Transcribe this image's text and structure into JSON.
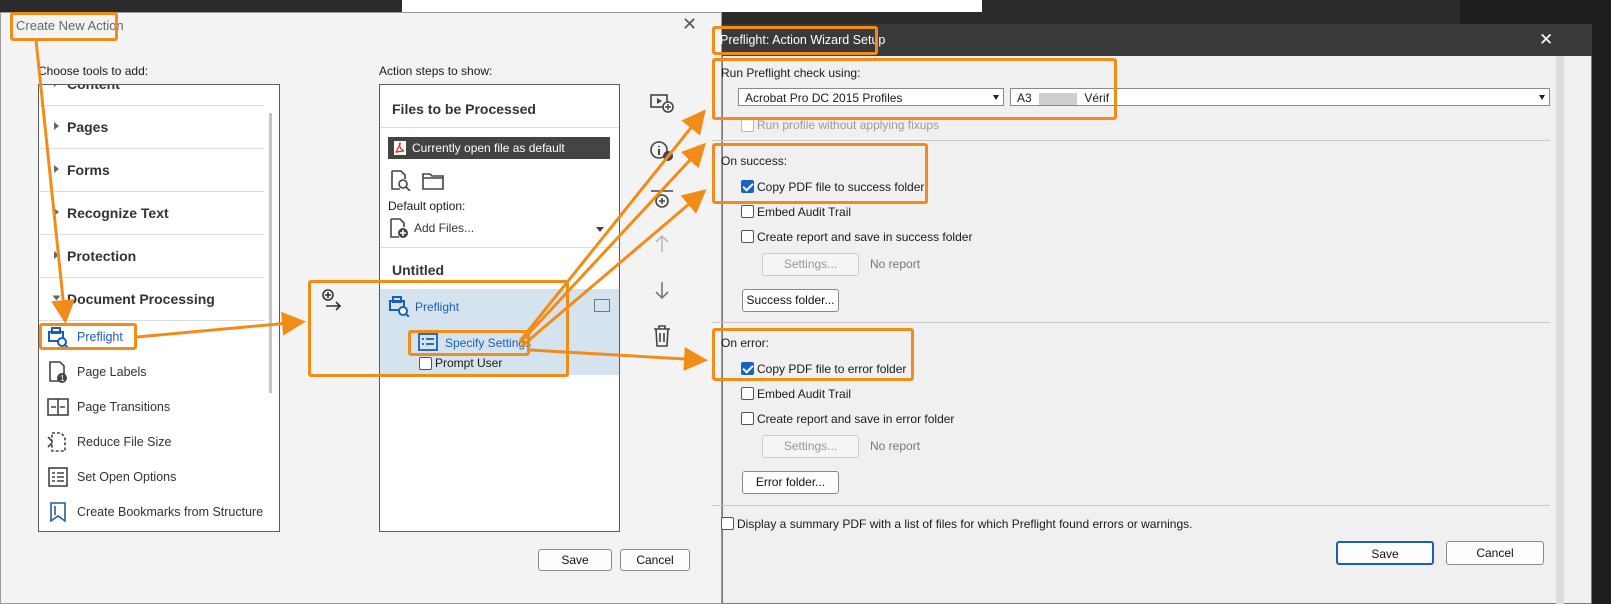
{
  "create_action": {
    "title": "Create New Action",
    "choose_tools_label": "Choose tools to add:",
    "action_steps_label": "Action steps to show:",
    "categories": [
      "Content",
      "Pages",
      "Forms",
      "Recognize Text",
      "Protection",
      "Document Processing"
    ],
    "tools": [
      "Preflight",
      "Page Labels",
      "Page Transitions",
      "Reduce File Size",
      "Set Open Options",
      "Create Bookmarks from Structure"
    ],
    "files_header": "Files to be Processed",
    "open_file_label": "Currently open file as default",
    "default_option_label": "Default option:",
    "add_files_label": "Add Files...",
    "untitled_header": "Untitled",
    "step_preflight": "Preflight",
    "step_specify": "Specify Settings",
    "step_prompt": "Prompt User",
    "save_label": "Save",
    "cancel_label": "Cancel"
  },
  "preflight": {
    "title": "Preflight: Action Wizard Setup",
    "run_label": "Run Preflight check using:",
    "profile_select": "Acrobat Pro DC 2015 Profiles",
    "profile_value_a": "A3",
    "profile_value_b": "Vérif",
    "run_without_fixups": "Run profile without applying fixups",
    "on_success": "On success:",
    "copy_success": "Copy PDF file to success folder",
    "embed_audit_1": "Embed Audit Trail",
    "report_success": "Create report and save in success folder",
    "settings_1": "Settings...",
    "no_report_1": "No report",
    "success_folder": "Success folder...",
    "on_error": "On error:",
    "copy_error": "Copy PDF file to error folder",
    "embed_audit_2": "Embed Audit Trail",
    "report_error": "Create report and save in error folder",
    "settings_2": "Settings...",
    "no_report_2": "No report",
    "error_folder": "Error folder...",
    "summary_label": "Display a summary PDF with a list of files for which Preflight found errors or warnings.",
    "save_label": "Save",
    "cancel_label": "Cancel"
  },
  "colors": {
    "annotation": "#f28c18",
    "link_blue": "#1a5fb4",
    "check_blue": "#1565c0"
  }
}
